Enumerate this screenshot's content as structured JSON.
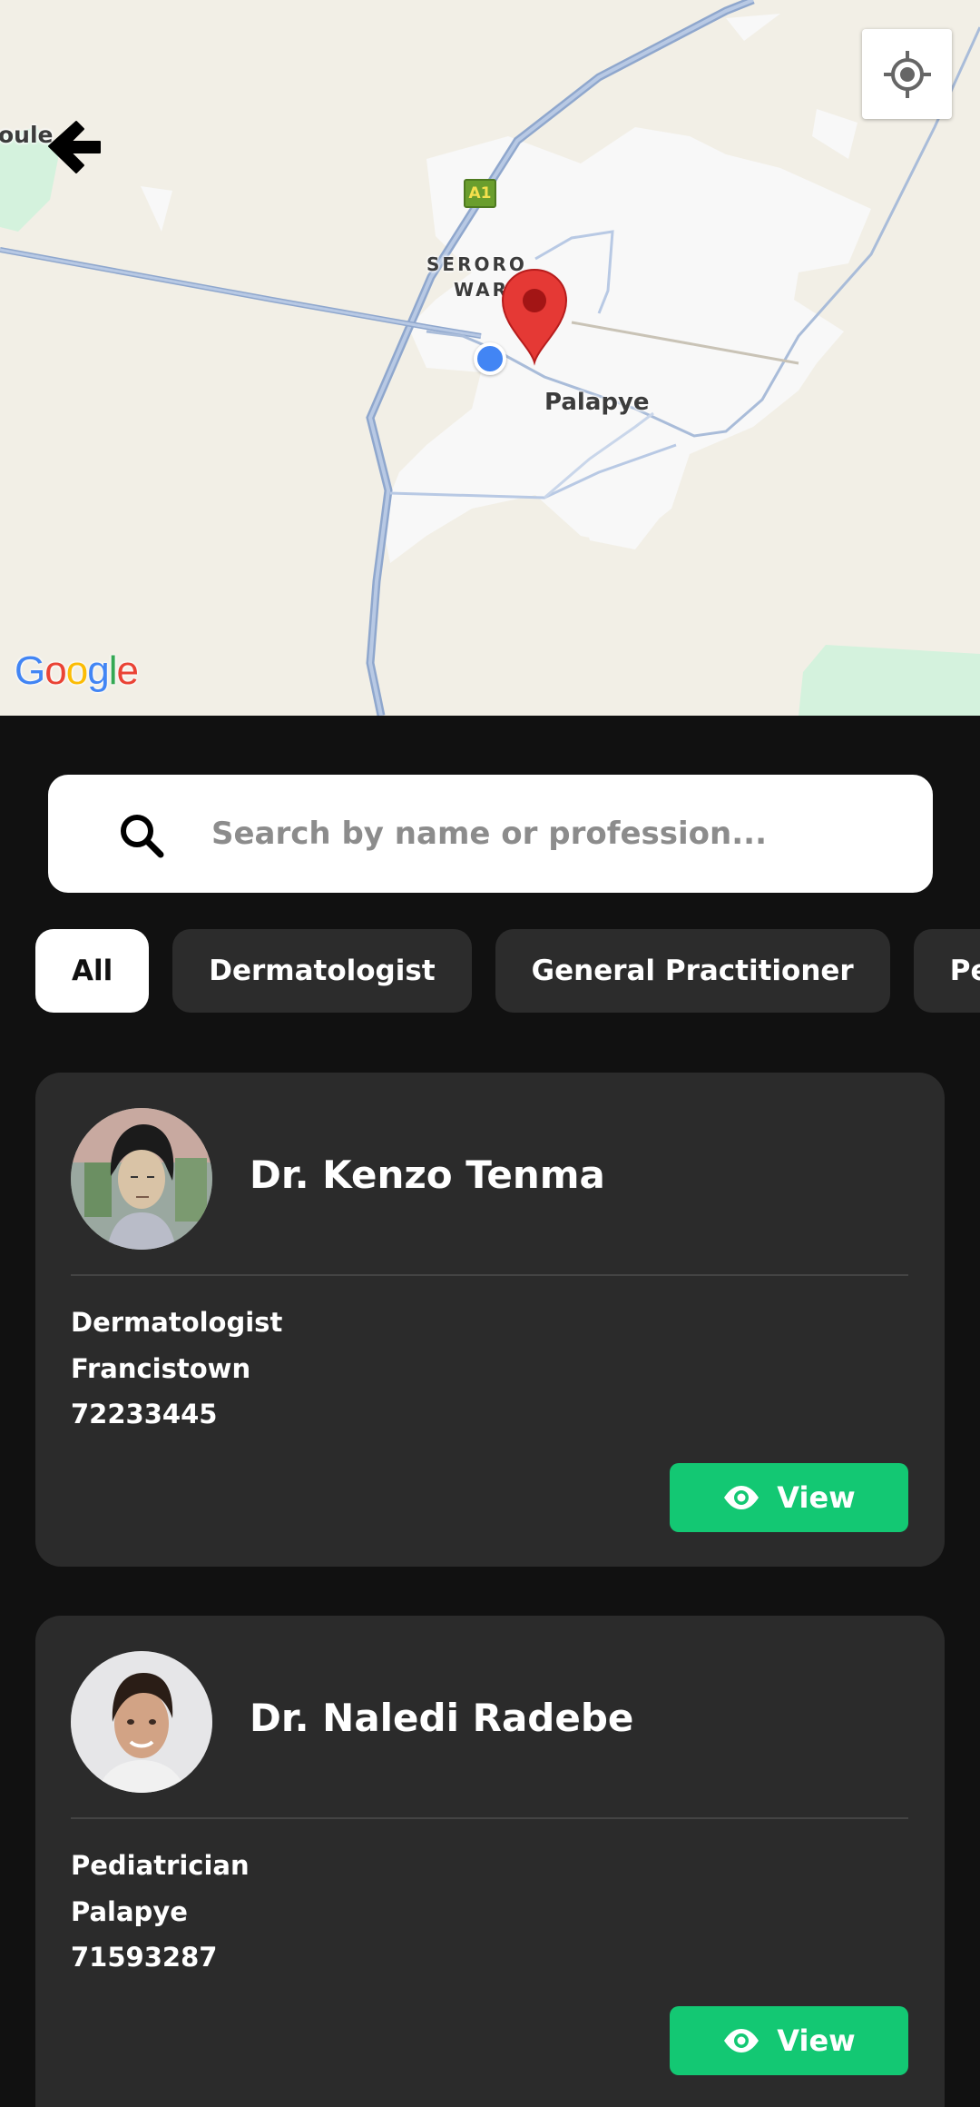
{
  "map": {
    "town_label": "Palapye",
    "ward_label_line1": "SERORO",
    "ward_label_line2": "WAR",
    "edge_label": "oule",
    "road_shield": "A1",
    "attribution": "Google",
    "icons": {
      "back": "arrow-left-icon",
      "locate": "my-location-icon",
      "pin": "map-pin-icon",
      "user": "user-location-dot"
    },
    "colors": {
      "land": "#f2efe6",
      "built": "#f8f8f8",
      "road": "#9db4d8",
      "green": "#d4f2dd",
      "pin": "#e53935"
    }
  },
  "search": {
    "placeholder": "Search by name or profession...",
    "value": "",
    "icon": "search-icon"
  },
  "filters": {
    "active": "All",
    "chips": [
      "All",
      "Dermatologist",
      "General Practitioner",
      "Pediatrician"
    ]
  },
  "doctors": [
    {
      "name": "Dr. Kenzo Tenma",
      "profession": "Dermatologist",
      "city": "Francistown",
      "phone": "72233445",
      "view_label": "View"
    },
    {
      "name": "Dr. Naledi Radebe",
      "profession": "Pediatrician",
      "city": "Palapye",
      "phone": "71593287",
      "view_label": "View"
    }
  ],
  "theme": {
    "background": "#111111",
    "card": "#2b2b2b",
    "accent": "#13c873"
  }
}
